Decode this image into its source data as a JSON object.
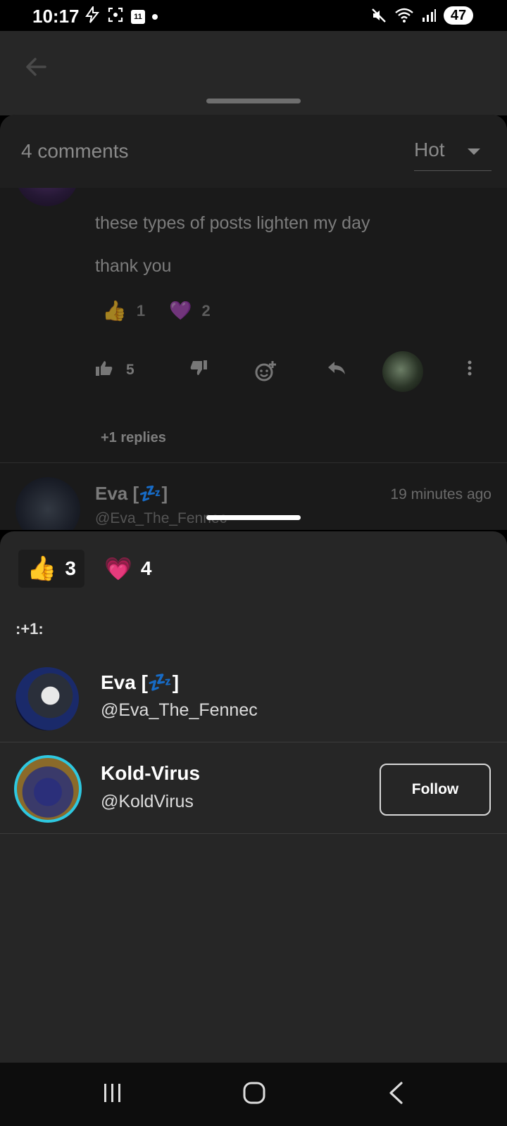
{
  "status_bar": {
    "time": "10:17",
    "calendar_day": "11",
    "battery": "47"
  },
  "comments": {
    "count_label": "4 comments",
    "sort_value": "Hot",
    "first_comment": {
      "lines": [
        "these types of posts lighten my day",
        "thank you"
      ],
      "reactions": [
        {
          "emoji": "👍",
          "count": "1"
        },
        {
          "emoji": "💜",
          "count": "2"
        }
      ],
      "upvotes": "5",
      "replies_label": "+1 replies"
    },
    "second_comment": {
      "name": "Eva [💤]",
      "handle": "@Eva_The_Fennec",
      "time": "19 minutes ago"
    }
  },
  "reaction_sheet": {
    "tabs": [
      {
        "emoji": "👍",
        "count": "3"
      },
      {
        "emoji": "💗",
        "count": "4"
      }
    ],
    "section_title": ":+1:",
    "users": [
      {
        "name": "Eva [💤]",
        "handle": "@Eva_The_Fennec"
      },
      {
        "name": "Kold-Virus",
        "handle": "@KoldVirus",
        "button": "Follow"
      }
    ]
  },
  "colors": {
    "sheet": "#262626",
    "accent_pink": "#ff3fa8"
  },
  "icons": [
    "back-arrow-icon",
    "thumbs-up-icon",
    "thumbs-down-icon",
    "add-reaction-icon",
    "reply-icon",
    "more-icon",
    "recents-icon",
    "home-icon",
    "back-icon"
  ]
}
